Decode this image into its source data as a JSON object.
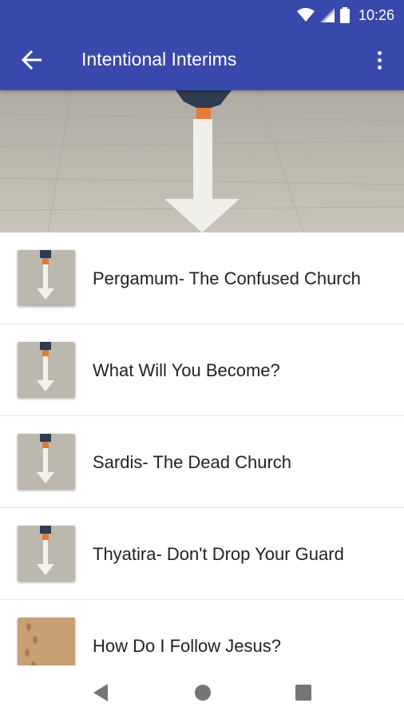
{
  "status_bar": {
    "time": "10:26",
    "icons": [
      "wifi-icon",
      "signal-icon",
      "battery-icon"
    ]
  },
  "app_bar": {
    "title": "Intentional Interims",
    "back_icon": "arrow-back-icon",
    "menu_icon": "more-vert-icon"
  },
  "colors": {
    "primary": "#3949ab",
    "text": "#222222"
  },
  "sermons": [
    {
      "title": "Pergamum- The Confused Church",
      "thumb": "arrow-road-thumb"
    },
    {
      "title": "What Will You Become?",
      "thumb": "arrow-road-thumb"
    },
    {
      "title": "Sardis- The Dead Church",
      "thumb": "arrow-road-thumb"
    },
    {
      "title": "Thyatira- Don't Drop Your Guard",
      "thumb": "arrow-road-thumb"
    },
    {
      "title": "How Do I Follow Jesus?",
      "thumb": "sand-footprints-thumb"
    }
  ],
  "nav": {
    "icons": [
      "back-triangle-icon",
      "home-circle-icon",
      "recents-square-icon"
    ]
  }
}
